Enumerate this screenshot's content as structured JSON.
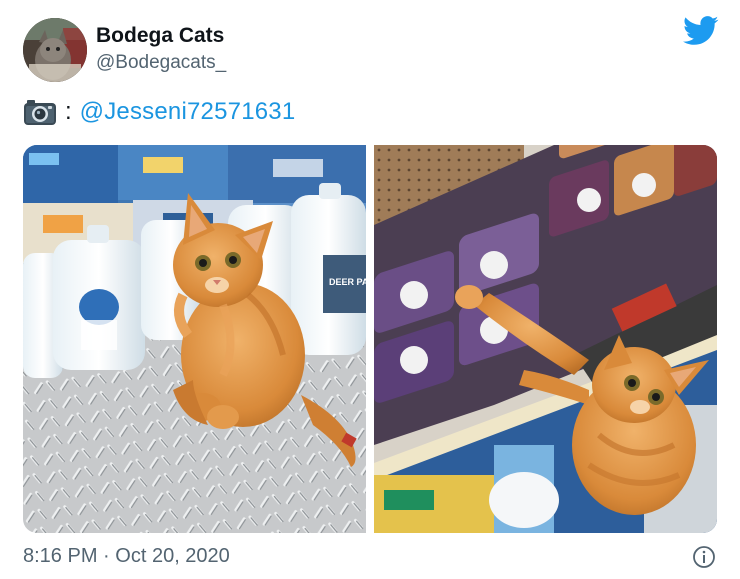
{
  "account": {
    "name": "Bodega Cats",
    "handle": "@Bodegacats_"
  },
  "caption": {
    "icon": "camera-icon",
    "separator": ":",
    "mention": "@Jesseni72571631"
  },
  "media": {
    "left_photo": {
      "icon": "photo-cat-on-floor",
      "product_label": "DEER PARK"
    },
    "right_photo": {
      "icon": "photo-cat-reaching-shelf"
    }
  },
  "footer": {
    "time": "8:16 PM",
    "dot": "·",
    "date": "Oct 20, 2020",
    "info_icon": "info-icon"
  },
  "colors": {
    "brand_blue": "#1d9bf0",
    "mention_blue": "#1b95e0",
    "muted_text": "#536471",
    "cat_orange": "#d98a3a"
  }
}
